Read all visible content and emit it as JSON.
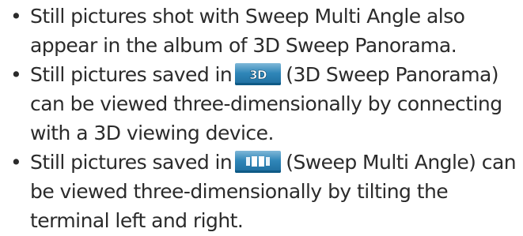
{
  "bullet_char": "•",
  "items": [
    {
      "lines": [
        "Still pictures shot with Sweep Multi Angle also",
        "appear in the album of 3D Sweep Panorama."
      ]
    },
    {
      "first_before": "Still pictures saved in",
      "icon": "3d-sweep-panorama-icon",
      "icon_text": "3D",
      "first_after": "(3D Sweep Panorama)",
      "rest": [
        "can be viewed three-dimensionally by connecting",
        "with a 3D viewing device."
      ]
    },
    {
      "first_before": "Still pictures saved in",
      "icon": "sweep-multi-angle-icon",
      "first_after": "(Sweep Multi Angle) can",
      "rest": [
        "be viewed three-dimensionally by tilting the",
        "terminal left and right."
      ]
    }
  ]
}
